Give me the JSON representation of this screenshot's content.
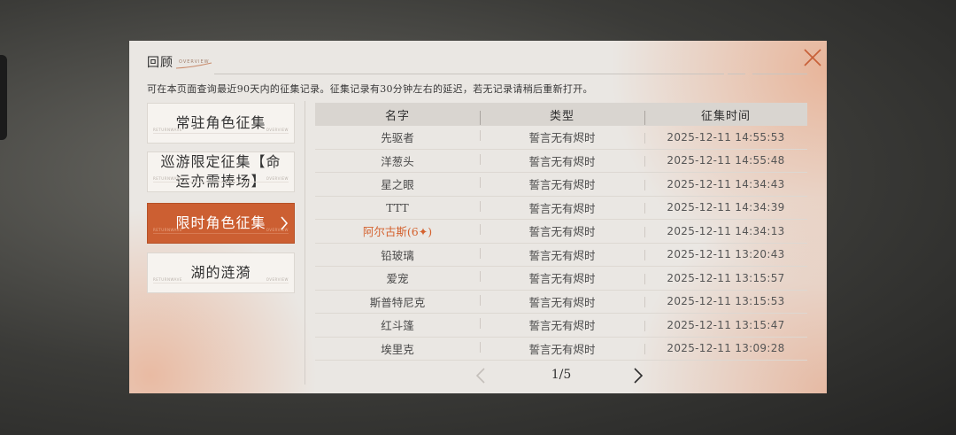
{
  "header": {
    "title": "回顾",
    "subtitle_tag": "OVERVIEW",
    "notice": "可在本页面查询最近90天内的征集记录。征集记录有30分钟左右的延迟，若无记录请稍后重新打开。"
  },
  "tabs": [
    {
      "label": "常驻角色征集",
      "active": false
    },
    {
      "label": "巡游限定征集【命运亦需捧场】",
      "active": false
    },
    {
      "label": "限时角色征集",
      "active": true
    },
    {
      "label": "湖的涟漪",
      "active": false
    }
  ],
  "tab_deco": {
    "left": "RETURNWAVE",
    "right": "OVERVIEW"
  },
  "table": {
    "headers": [
      "名字",
      "类型",
      "征集时间"
    ],
    "rows": [
      {
        "name": "先驱者",
        "type": "誓言无有烬时",
        "time": "2025-12-11 14:55:53",
        "highlight": false
      },
      {
        "name": "洋葱头",
        "type": "誓言无有烬时",
        "time": "2025-12-11 14:55:48",
        "highlight": false
      },
      {
        "name": "星之眼",
        "type": "誓言无有烬时",
        "time": "2025-12-11 14:34:43",
        "highlight": false
      },
      {
        "name": "TTT",
        "type": "誓言无有烬时",
        "time": "2025-12-11 14:34:39",
        "highlight": false
      },
      {
        "name": "阿尔古斯(6✦)",
        "type": "誓言无有烬时",
        "time": "2025-12-11 14:34:13",
        "highlight": true
      },
      {
        "name": "铅玻璃",
        "type": "誓言无有烬时",
        "time": "2025-12-11 13:20:43",
        "highlight": false
      },
      {
        "name": "爱宠",
        "type": "誓言无有烬时",
        "time": "2025-12-11 13:15:57",
        "highlight": false
      },
      {
        "name": "斯普特尼克",
        "type": "誓言无有烬时",
        "time": "2025-12-11 13:15:53",
        "highlight": false
      },
      {
        "name": "红斗篷",
        "type": "誓言无有烬时",
        "time": "2025-12-11 13:15:47",
        "highlight": false
      },
      {
        "name": "埃里克",
        "type": "誓言无有烬时",
        "time": "2025-12-11 13:09:28",
        "highlight": false
      }
    ]
  },
  "pager": {
    "text": "1/5",
    "current": 1,
    "total": 5
  },
  "icons": {
    "close": "close-icon",
    "prev": "chevron-left-icon",
    "next": "chevron-right-icon",
    "tab_arrow": "chevron-right-icon"
  },
  "colors": {
    "accent": "#cc5f32",
    "highlight_text": "#d4622f",
    "panel_bg": "#eae7e3"
  }
}
